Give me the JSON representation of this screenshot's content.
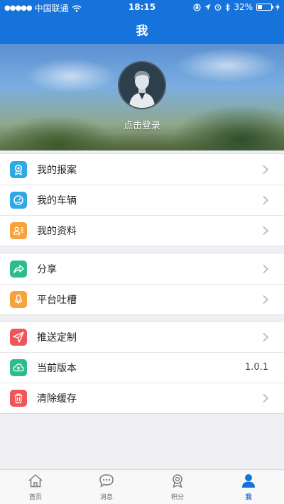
{
  "status_bar": {
    "carrier": "中国联通",
    "time": "18:15",
    "battery_text": "32%",
    "battery_level": 0.32
  },
  "nav": {
    "title": "我"
  },
  "profile": {
    "login_text": "点击登录"
  },
  "menu_groups": [
    {
      "items": [
        {
          "label": "我的报案",
          "icon": "badge-icon",
          "color": "#2fa8e8"
        },
        {
          "label": "我的车辆",
          "icon": "speedometer-icon",
          "color": "#2fa8e8"
        },
        {
          "label": "我的资料",
          "icon": "profile-card-icon",
          "color": "#f7a23a"
        }
      ]
    },
    {
      "items": [
        {
          "label": "分享",
          "icon": "share-icon",
          "color": "#2dbd8c"
        },
        {
          "label": "平台吐槽",
          "icon": "microphone-icon",
          "color": "#f7a23a"
        }
      ]
    },
    {
      "items": [
        {
          "label": "推送定制",
          "icon": "send-icon",
          "color": "#f0555a"
        },
        {
          "label": "当前版本",
          "icon": "cloud-upload-icon",
          "color": "#2dbd8c",
          "value": "1.0.1"
        },
        {
          "label": "清除缓存",
          "icon": "trash-icon",
          "color": "#f0555a"
        }
      ]
    }
  ],
  "tabs": [
    {
      "label": "首页",
      "icon": "home-icon",
      "active": false
    },
    {
      "label": "消息",
      "icon": "message-icon",
      "active": false
    },
    {
      "label": "积分",
      "icon": "medal-icon",
      "active": false
    },
    {
      "label": "我",
      "icon": "person-icon",
      "active": true
    }
  ],
  "colors": {
    "brand": "#1673dc",
    "background": "#efeff4"
  }
}
